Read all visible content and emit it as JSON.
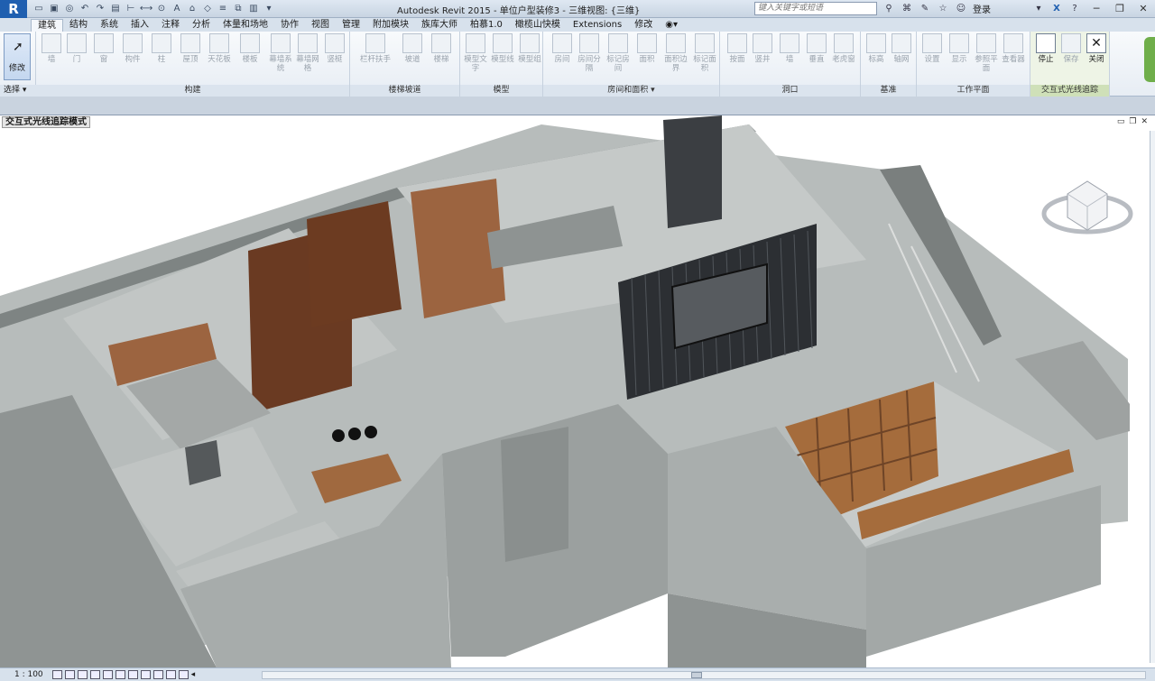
{
  "app": {
    "logo": "R",
    "title": "Autodesk Revit 2015 -    单位户型装修3 - 三维视图: {三维}",
    "search_placeholder": "键入关键字或短语",
    "login_label": "登录"
  },
  "tabs": [
    "建筑",
    "结构",
    "系统",
    "插入",
    "注释",
    "分析",
    "体量和场地",
    "协作",
    "视图",
    "管理",
    "附加模块",
    "族库大师",
    "柏慕1.0",
    "橄榄山快模",
    "Extensions",
    "修改"
  ],
  "ribbon": {
    "modify_label": "修改",
    "select_label": "选择",
    "panels": [
      {
        "title": "构建",
        "buttons": [
          "墙",
          "门",
          "窗",
          "构件",
          "柱",
          "屋顶",
          "天花板",
          "楼板",
          "幕墙系统",
          "幕墙网格",
          "竖梃"
        ]
      },
      {
        "title": "楼梯坡道",
        "buttons": [
          "栏杆扶手",
          "坡道",
          "楼梯"
        ]
      },
      {
        "title": "模型",
        "buttons": [
          "模型文字",
          "模型线",
          "模型组"
        ]
      },
      {
        "title": "房间和面积",
        "buttons": [
          "房间",
          "房间分隔",
          "标记房间",
          "面积",
          "面积边界",
          "标记面积"
        ]
      },
      {
        "title": "洞口",
        "buttons": [
          "按面",
          "竖井",
          "墙",
          "垂直",
          "老虎窗"
        ]
      },
      {
        "title": "基准",
        "buttons": [
          "标高",
          "轴网"
        ]
      },
      {
        "title": "工作平面",
        "buttons": [
          "设置",
          "显示",
          "参照平面",
          "查看器"
        ]
      },
      {
        "title": "交互式光线追踪",
        "buttons": [
          "停止",
          "保存",
          "关闭"
        ]
      }
    ]
  },
  "view": {
    "mode_label": "交互式光线追踪模式"
  },
  "status": {
    "scale": "1 : 100"
  },
  "colors": {
    "accent": "#1f5fb0",
    "wood": "#9a6b45",
    "wall": "#8d9291"
  }
}
